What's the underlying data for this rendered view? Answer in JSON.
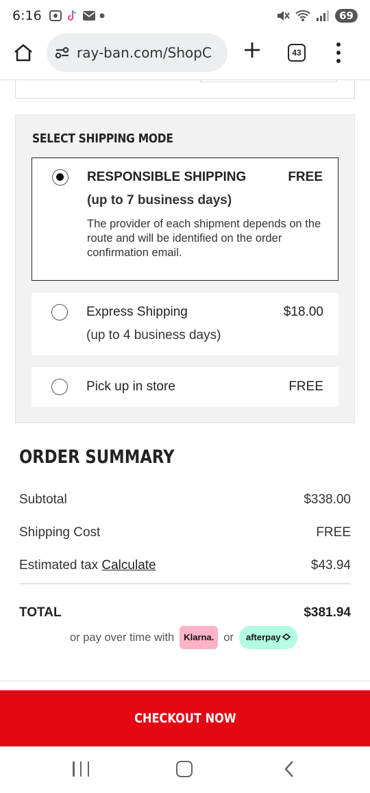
{
  "status_bar": {
    "time": "6:16",
    "battery": "69",
    "icons": [
      "screenshot-icon",
      "tiktok-icon",
      "mail-icon",
      "dot-icon",
      "mute-icon",
      "wifi-icon",
      "signal-icon"
    ]
  },
  "browser": {
    "url": "ray-ban.com/ShopC",
    "tab_count": "43"
  },
  "shipping": {
    "title": "SELECT SHIPPING MODE",
    "options": [
      {
        "name": "RESPONSIBLE SHIPPING",
        "sub": "(up to 7 business days)",
        "price": "FREE",
        "description": "The provider of each shipment depends on the route and will be identified on the order confirmation email.",
        "selected": true
      },
      {
        "name": "Express Shipping",
        "sub": "(up to 4 business days)",
        "price": "$18.00",
        "selected": false
      },
      {
        "name": "Pick up in store",
        "price": "FREE",
        "selected": false
      }
    ]
  },
  "summary": {
    "title": "ORDER SUMMARY",
    "subtotal_label": "Subtotal",
    "subtotal_value": "$338.00",
    "shipping_label": "Shipping Cost",
    "shipping_value": "FREE",
    "tax_label": "Estimated tax",
    "tax_link": "Calculate",
    "tax_value": "$43.94",
    "total_label": "TOTAL",
    "total_value": "$381.94"
  },
  "pay_later": {
    "prefix": "or pay over time with",
    "klarna": "Klarna.",
    "or": "or",
    "afterpay": "afterpay"
  },
  "checkout": {
    "label": "CHECKOUT NOW",
    "color": "#e30613"
  }
}
